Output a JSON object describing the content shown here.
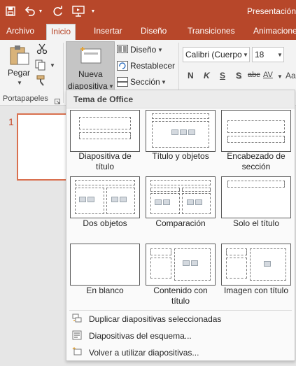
{
  "app": {
    "title": "Presentación"
  },
  "quick_access": {
    "save_icon": "save-icon",
    "undo_icon": "undo-icon",
    "redo_icon": "redo-icon",
    "start_icon": "presentation-start-icon",
    "customize_icon": "chevron-down-icon"
  },
  "tabs": [
    {
      "label": "Archivo"
    },
    {
      "label": "Inicio",
      "active": true
    },
    {
      "label": "Insertar"
    },
    {
      "label": "Diseño"
    },
    {
      "label": "Transiciones"
    },
    {
      "label": "Animaciones"
    }
  ],
  "ribbon": {
    "paste_label": "Pegar",
    "new_slide_line1": "Nueva",
    "new_slide_line2": "diapositiva",
    "layout_label": "Diseño",
    "reset_label": "Restablecer",
    "section_label": "Sección",
    "clipboard_group_label": "Portapapeles",
    "font_name": "Calibri (Cuerpo",
    "font_size": "18",
    "bold": "N",
    "italic": "K",
    "underline": "S",
    "shadow": "S",
    "strikethrough": "abc",
    "spacing": "AV",
    "case": "Aa"
  },
  "slide_panel": {
    "slide_number": "1"
  },
  "dropdown": {
    "header": "Tema de Office",
    "layouts": [
      {
        "label_line1": "Diapositiva de",
        "label_line2": "título"
      },
      {
        "label_line1": "Título y objetos",
        "label_line2": ""
      },
      {
        "label_line1": "Encabezado de",
        "label_line2": "sección"
      },
      {
        "label_line1": "Dos objetos",
        "label_line2": ""
      },
      {
        "label_line1": "Comparación",
        "label_line2": ""
      },
      {
        "label_line1": "Solo el título",
        "label_line2": ""
      },
      {
        "label_line1": "En blanco",
        "label_line2": ""
      },
      {
        "label_line1": "Contenido con",
        "label_line2": "título"
      },
      {
        "label_line1": "Imagen con título",
        "label_line2": ""
      }
    ],
    "menu": [
      {
        "label": "Duplicar diapositivas seleccionadas",
        "icon": "duplicate-slides-icon"
      },
      {
        "label": "Diapositivas del esquema...",
        "icon": "outline-slides-icon"
      },
      {
        "label": "Volver a utilizar diapositivas...",
        "icon": "reuse-slides-icon"
      }
    ]
  },
  "colors": {
    "accent": "#b7472a",
    "ribbon": "#f3f3f3",
    "thumb_border": "#d9704f"
  }
}
